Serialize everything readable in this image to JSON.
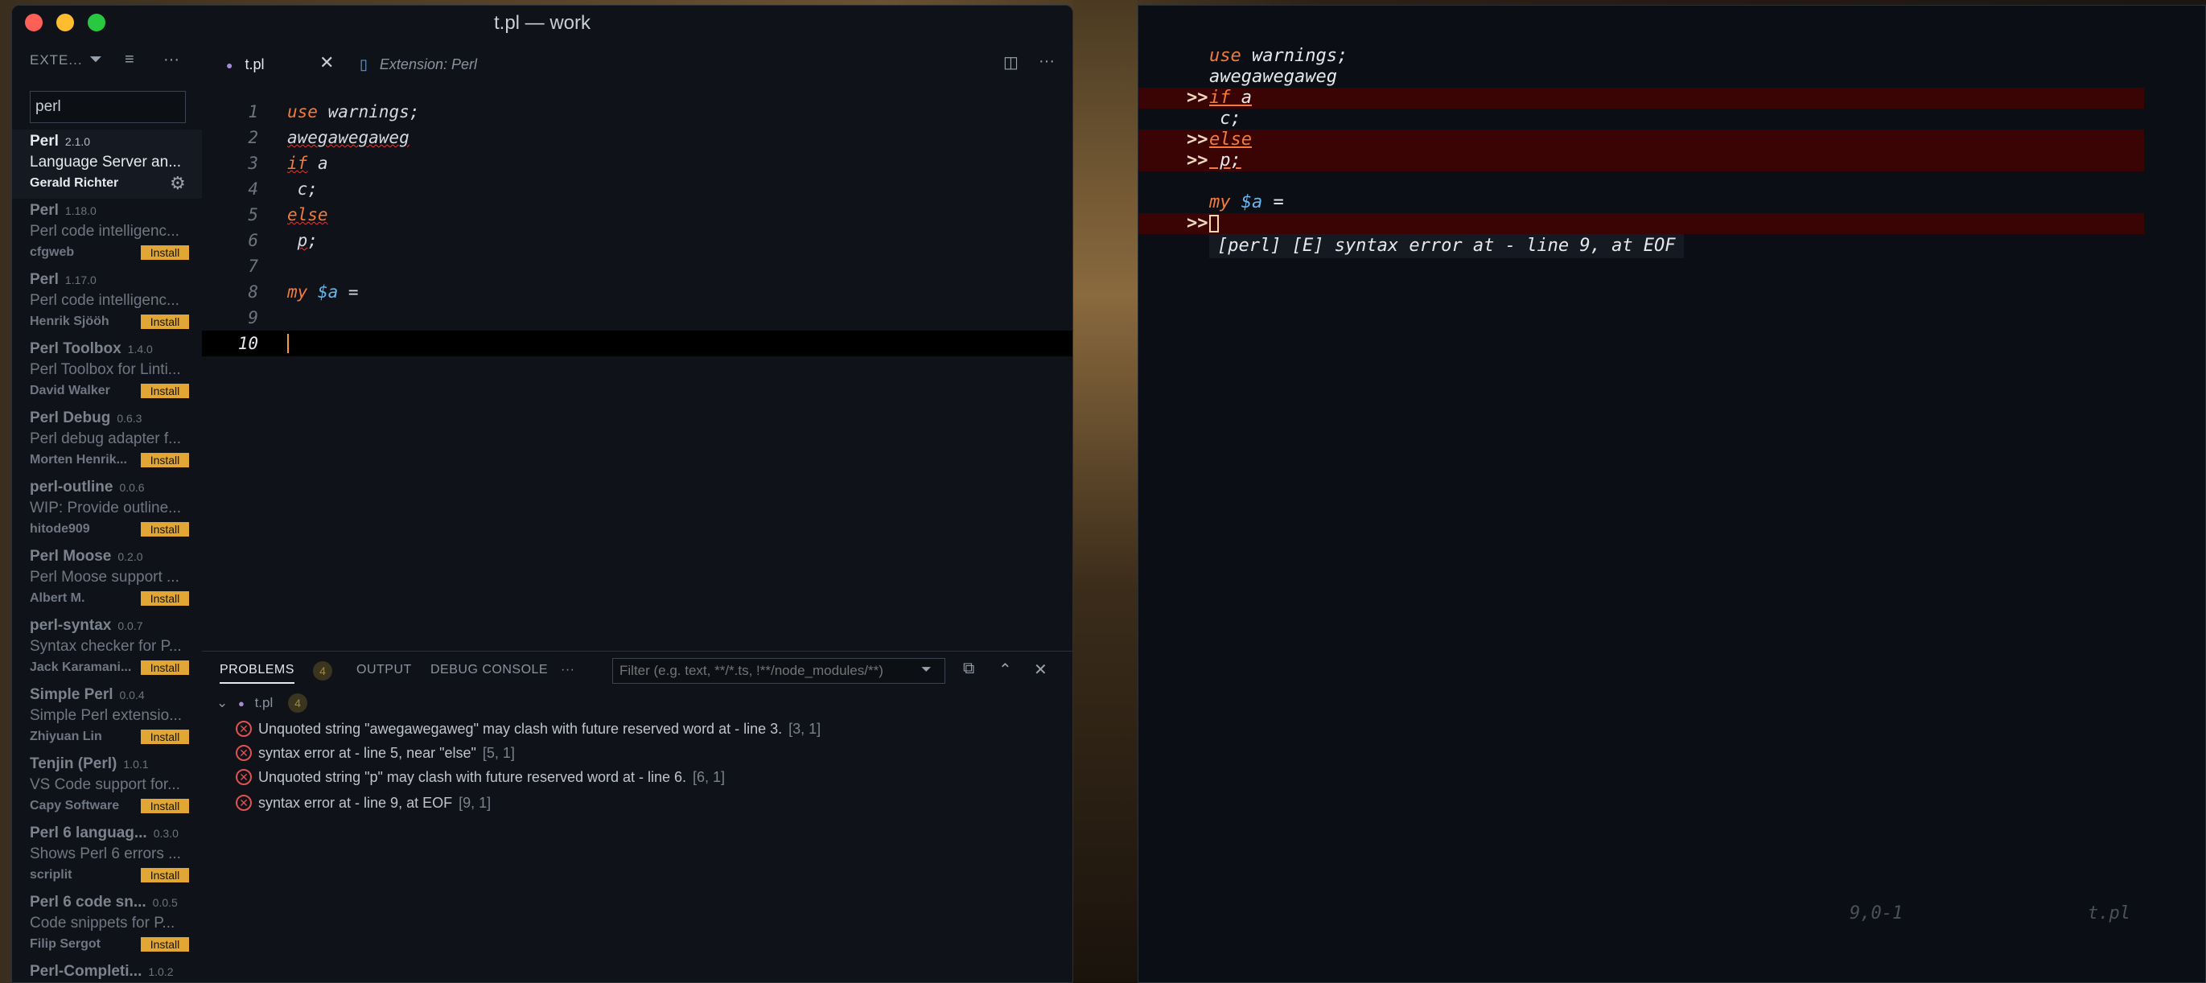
{
  "vscode": {
    "window_title": "t.pl — work",
    "sidebar": {
      "header": "EXTE...",
      "search_value": "perl",
      "extensions": [
        {
          "name": "Perl",
          "version": "2.1.0",
          "desc": "Language Server an...",
          "publisher": "Gerald Richter",
          "installed": true
        },
        {
          "name": "Perl",
          "version": "1.18.0",
          "desc": "Perl code intelligenc...",
          "publisher": "cfgweb",
          "installed": false
        },
        {
          "name": "Perl",
          "version": "1.17.0",
          "desc": "Perl code intelligenc...",
          "publisher": "Henrik Sjööh",
          "installed": false
        },
        {
          "name": "Perl Toolbox",
          "version": "1.4.0",
          "desc": "Perl Toolbox for Linti...",
          "publisher": "David Walker",
          "installed": false
        },
        {
          "name": "Perl Debug",
          "version": "0.6.3",
          "desc": "Perl debug adapter f...",
          "publisher": "Morten Henrik...",
          "installed": false
        },
        {
          "name": "perl-outline",
          "version": "0.0.6",
          "desc": "WIP: Provide outline...",
          "publisher": "hitode909",
          "installed": false
        },
        {
          "name": "Perl Moose",
          "version": "0.2.0",
          "desc": "Perl Moose support ...",
          "publisher": "Albert M.",
          "installed": false
        },
        {
          "name": "perl-syntax",
          "version": "0.0.7",
          "desc": "Syntax checker for P...",
          "publisher": "Jack Karamani...",
          "installed": false
        },
        {
          "name": "Simple Perl",
          "version": "0.0.4",
          "desc": "Simple Perl extensio...",
          "publisher": "Zhiyuan Lin",
          "installed": false
        },
        {
          "name": "Tenjin (Perl)",
          "version": "1.0.1",
          "desc": "VS Code support for...",
          "publisher": "Capy Software",
          "installed": false
        },
        {
          "name": "Perl 6 languag...",
          "version": "0.3.0",
          "desc": "Shows Perl 6 errors ...",
          "publisher": "scriplit",
          "installed": false
        },
        {
          "name": "Perl 6 code sn...",
          "version": "0.0.5",
          "desc": "Code snippets for P...",
          "publisher": "Filip Sergot",
          "installed": false
        },
        {
          "name": "Perl-Completi...",
          "version": "1.0.2",
          "desc": "",
          "publisher": "",
          "installed": false
        }
      ],
      "install_label": "Install"
    },
    "tabs": [
      {
        "label": "t.pl",
        "active": true
      },
      {
        "label": "Extension: Perl",
        "active": false
      }
    ],
    "editor": {
      "line_numbers": [
        "1",
        "2",
        "3",
        "4",
        "5",
        "6",
        "7",
        "8",
        "9",
        "10"
      ],
      "current_line": "10"
    },
    "panel": {
      "tabs": [
        "PROBLEMS",
        "OUTPUT",
        "DEBUG CONSOLE"
      ],
      "problem_count": "4",
      "more": "···",
      "filter_placeholder": "Filter (e.g. text, **/*.ts, !**/node_modules/**)",
      "file": "t.pl",
      "file_count": "4",
      "problems": [
        {
          "msg": "Unquoted string \"awegawegaweg\" may clash with future reserved word at - line 3.",
          "loc": "[3, 1]"
        },
        {
          "msg": "syntax error at - line 5, near \"else\"",
          "loc": "[5, 1]"
        },
        {
          "msg": "Unquoted string \"p\" may clash with future reserved word at - line 6.",
          "loc": "[6, 1]"
        },
        {
          "msg": "syntax error at - line 9, at EOF",
          "loc": "[9, 1]"
        }
      ]
    }
  },
  "vim": {
    "sign": ">>",
    "message": "[perl] [E] syntax error at - line 9, at EOF",
    "status_pos": "9,0-1",
    "status_file": "t.pl"
  },
  "colors": {
    "keyword": "#f47a3a",
    "variable": "#66b7f0",
    "install": "#e2a634",
    "error_line": "#3a0404",
    "error_icon": "#e05252"
  }
}
